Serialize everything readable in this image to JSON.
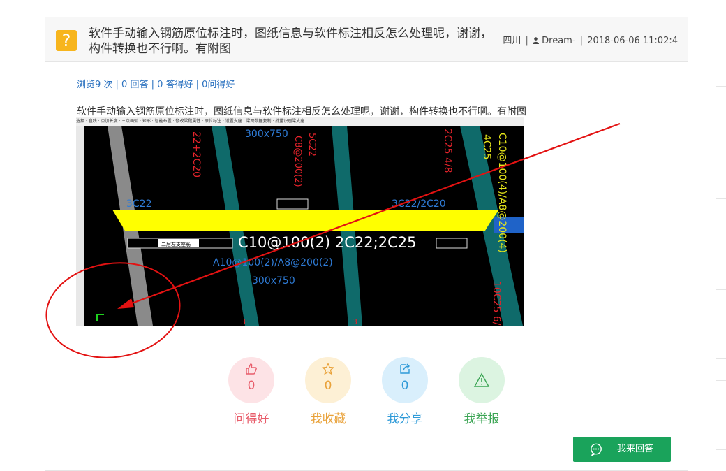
{
  "question": {
    "icon": "?",
    "title": "软件手动输入钢筋原位标注时，图纸信息与软件标注相反怎么处理呢，谢谢，构件转换也不行啊。有附图",
    "location": "四川",
    "user_icon": "user-icon",
    "user": "Dream-",
    "time": "2018-06-06 11:02:4",
    "stats": "浏览9 次 | 0 回答 | 0 答得好 | 0问得好",
    "body": "软件手动输入钢筋原位标注时，图纸信息与软件标注相反怎么处理呢，谢谢，构件转换也不行啊。有附图"
  },
  "attachment": {
    "toolbar": "选择 · 直线 · 点加长度 · 三点画弧 ·    矩形 · 智能布置 · 修改梁段属性 · 原位标注 · 设置支座 · 梁跨数据复制 · 批量识别梁支座",
    "labels": {
      "top_left": "22+2C20",
      "size_top": "300x750",
      "mid1": "5C22",
      "mid2": "C8@200(2)",
      "right1": "2C25 4/8",
      "right2": "4C25",
      "right3": "C10@100(4)/A8@200(4)",
      "left_blue": "3C22",
      "right_blue": "3C22/2C20",
      "main": "C10@100(2) 2C22;2C25",
      "blue_line": "A10@100(2)/A8@200(2)",
      "size_bottom": "300x750",
      "far_right": "10C25 6/",
      "popup": "二层左支座筋",
      "mark1": "3",
      "mark2": "3"
    },
    "colors": {
      "yellow": "#ffff00",
      "teal": "#0f6a6a",
      "annot": "#e31212",
      "blue": "#2e7bd6"
    }
  },
  "actions": [
    {
      "label": "问得好",
      "count": "0",
      "icon": "thumbs-up-icon",
      "bg": "#fde3e6",
      "color": "#e85d6b"
    },
    {
      "label": "我收藏",
      "count": "0",
      "icon": "star-icon",
      "bg": "#fdf0d5",
      "color": "#e9a23a"
    },
    {
      "label": "我分享",
      "count": "0",
      "icon": "share-icon",
      "bg": "#d9effc",
      "color": "#2e9ad8"
    },
    {
      "label": "我举报",
      "count": "",
      "icon": "warning-icon",
      "bg": "#dcf4e1",
      "color": "#3ca555"
    }
  ],
  "answer_button": {
    "label": "我来回答",
    "icon": "chat-bubble-icon"
  }
}
